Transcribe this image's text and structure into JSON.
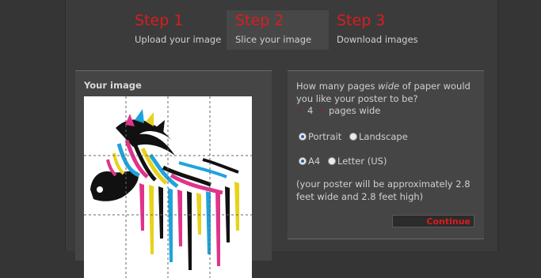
{
  "steps": [
    {
      "title": "Step 1",
      "subtitle": "Upload your image"
    },
    {
      "title": "Step 2",
      "subtitle": "Slice your image"
    },
    {
      "title": "Step 3",
      "subtitle": "Download images"
    }
  ],
  "image_panel": {
    "title": "Your image"
  },
  "options": {
    "question_prefix": "How many pages ",
    "question_emphasis": "wide",
    "question_suffix": " of paper would you like your poster to be?",
    "pages_count": "4",
    "pages_suffix": "pages wide",
    "orientation": [
      {
        "label": "Portrait",
        "selected": true
      },
      {
        "label": "Landscape",
        "selected": false
      }
    ],
    "paper_size": [
      {
        "label": "A4",
        "selected": true
      },
      {
        "label": "Letter (US)",
        "selected": false
      }
    ],
    "note": "(your poster will be approximately 2.8 feet wide and 2.8 feet high)",
    "continue_label": "Continue"
  },
  "colors": {
    "accent": "#dd1c1c",
    "background": "#353535",
    "panel": "#454545"
  }
}
